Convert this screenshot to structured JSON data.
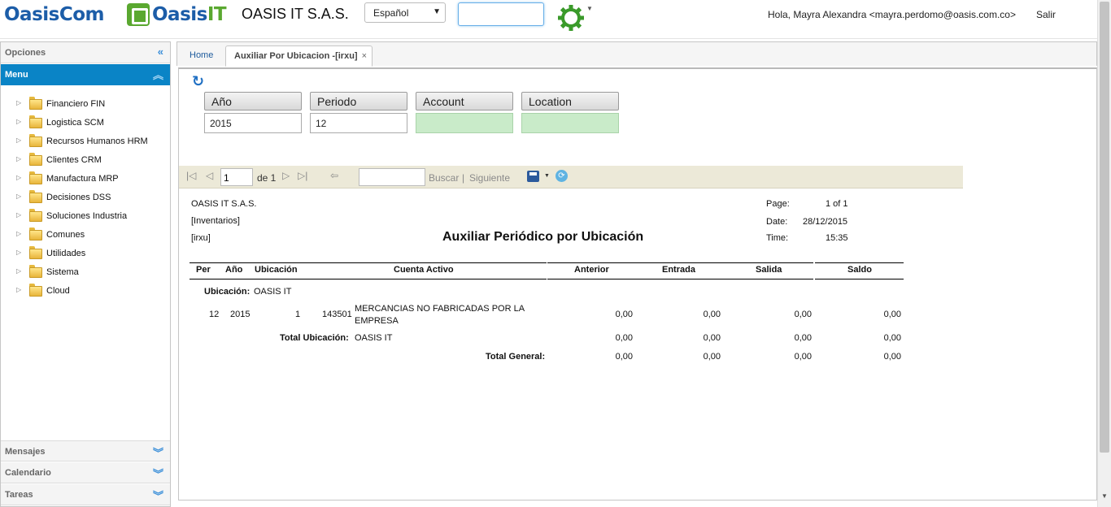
{
  "header": {
    "logo_primary": "OasisCom",
    "logo_secondary_a": "Oasis",
    "logo_secondary_b": "IT",
    "company": "OASIS IT S.A.S.",
    "language": "Español",
    "search_value": "",
    "greeting": "Hola, Mayra Alexandra <mayra.perdomo@oasis.com.co>",
    "logout": "Salir"
  },
  "sidebar": {
    "options_title": "Opciones",
    "menu_title": "Menu",
    "items": [
      {
        "label": "Financiero FIN"
      },
      {
        "label": "Logistica SCM"
      },
      {
        "label": "Recursos Humanos HRM"
      },
      {
        "label": "Clientes CRM"
      },
      {
        "label": "Manufactura MRP"
      },
      {
        "label": "Decisiones DSS"
      },
      {
        "label": "Soluciones Industria"
      },
      {
        "label": "Comunes"
      },
      {
        "label": "Utilidades"
      },
      {
        "label": "Sistema"
      },
      {
        "label": "Cloud"
      }
    ],
    "panels": {
      "messages": "Mensajes",
      "calendar": "Calendario",
      "tasks": "Tareas"
    }
  },
  "tabs": {
    "home": "Home",
    "active": "Auxiliar Por Ubicacion -[irxu]",
    "close": "×"
  },
  "params": {
    "year_label": "Año",
    "year_value": "2015",
    "period_label": "Periodo",
    "period_value": "12",
    "account_label": "Account",
    "account_value": "",
    "location_label": "Location",
    "location_value": ""
  },
  "toolbar": {
    "page": "1",
    "of_pages": "de 1",
    "find_value": "",
    "find": "Buscar",
    "separator": "|",
    "next": "Siguiente"
  },
  "report": {
    "company": "OASIS IT S.A.S.",
    "module": "[Inventarios]",
    "code": "[irxu]",
    "title": "Auxiliar Periódico por Ubicación",
    "page_label": "Page:",
    "page_value": "1 of 1",
    "date_label": "Date:",
    "date_value": "28/12/2015",
    "time_label": "Time:",
    "time_value": "15:35",
    "columns": {
      "per": "Per",
      "year": "Año",
      "location": "Ubicación",
      "account": "Cuenta Activo",
      "previous": "Anterior",
      "entry": "Entrada",
      "exit": "Salida",
      "balance": "Saldo"
    },
    "group_label": "Ubicación:",
    "group_value": "OASIS IT",
    "row": {
      "per": "12",
      "year": "2015",
      "location": "1",
      "account_code": "143501",
      "account_name_1": "MERCANCIAS NO FABRICADAS POR LA",
      "account_name_2": "EMPRESA",
      "previous": "0,00",
      "entry": "0,00",
      "exit": "0,00",
      "balance": "0,00"
    },
    "total_location": {
      "label": "Total Ubicación:",
      "value": "OASIS IT",
      "previous": "0,00",
      "entry": "0,00",
      "exit": "0,00",
      "balance": "0,00"
    },
    "total_general": {
      "label": "Total General:",
      "previous": "0,00",
      "entry": "0,00",
      "exit": "0,00",
      "balance": "0,00"
    }
  }
}
